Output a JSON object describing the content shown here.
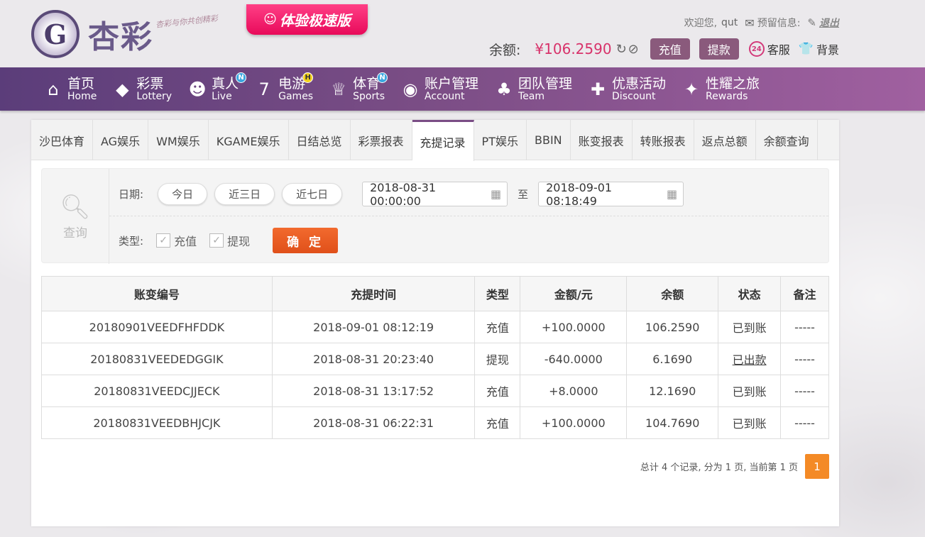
{
  "header": {
    "logo_mark": "G",
    "logo_text": "杏彩",
    "slogan": "杏彩与你共创精彩",
    "fast_badge": "体验极速版",
    "welcome": "欢迎您,",
    "username": "qut",
    "reserved_info": "预留信息:",
    "logout": "退出",
    "balance_label": "余额:",
    "balance_amount": "¥106.2590",
    "deposit": "充值",
    "withdraw": "提款",
    "service": "客服",
    "background": "背景",
    "service_badge": "24"
  },
  "nav": [
    {
      "zh": "首页",
      "en": "Home",
      "icon": "home-icon",
      "glyph": "⌂",
      "tag": ""
    },
    {
      "zh": "彩票",
      "en": "Lottery",
      "icon": "lottery-icon",
      "glyph": "◆",
      "tag": ""
    },
    {
      "zh": "真人",
      "en": "Live",
      "icon": "live-icon",
      "glyph": "☻",
      "tag": "N"
    },
    {
      "zh": "电游",
      "en": "Games",
      "icon": "games-icon",
      "glyph": "7",
      "tag": "H"
    },
    {
      "zh": "体育",
      "en": "Sports",
      "icon": "sports-icon",
      "glyph": "♕",
      "tag": "N"
    },
    {
      "zh": "账户管理",
      "en": "Account",
      "icon": "account-icon",
      "glyph": "◉",
      "tag": ""
    },
    {
      "zh": "团队管理",
      "en": "Team",
      "icon": "team-icon",
      "glyph": "♣",
      "tag": ""
    },
    {
      "zh": "优惠活动",
      "en": "Discount",
      "icon": "gift-icon",
      "glyph": "✚",
      "tag": ""
    },
    {
      "zh": "性耀之旅",
      "en": "Rewards",
      "icon": "rewards-icon",
      "glyph": "✦",
      "tag": ""
    }
  ],
  "tabs": [
    "沙巴体育",
    "AG娱乐",
    "WM娱乐",
    "KGAME娱乐",
    "日结总览",
    "彩票报表",
    "充提记录",
    "PT娱乐",
    "BBIN",
    "账变报表",
    "转账报表",
    "返点总额",
    "余额查询"
  ],
  "active_tab": "充提记录",
  "filter": {
    "query_label": "查询",
    "date_label": "日期:",
    "today": "今日",
    "last3": "近三日",
    "last7": "近七日",
    "start_date": "2018-08-31 00:00:00",
    "to": "至",
    "end_date": "2018-09-01 08:18:49",
    "type_label": "类型:",
    "type_deposit": "充值",
    "type_withdraw": "提现",
    "confirm": "确 定"
  },
  "table": {
    "headers": [
      "账变编号",
      "充提时间",
      "类型",
      "金额/元",
      "余额",
      "状态",
      "备注"
    ],
    "rows": [
      {
        "id": "20180901VEEDFHFDDK",
        "time": "2018-09-01 08:12:19",
        "type": "充值",
        "amount": "+100.0000",
        "balance": "106.2590",
        "status": "已到账",
        "note": "-----"
      },
      {
        "id": "20180831VEEDEDGGIK",
        "time": "2018-08-31 20:23:40",
        "type": "提现",
        "amount": "-640.0000",
        "balance": "6.1690",
        "status": "已出款",
        "note": "-----"
      },
      {
        "id": "20180831VEEDCJJECK",
        "time": "2018-08-31 13:17:52",
        "type": "充值",
        "amount": "+8.0000",
        "balance": "12.1690",
        "status": "已到账",
        "note": "-----"
      },
      {
        "id": "20180831VEEDBHJCJK",
        "time": "2018-08-31 06:22:31",
        "type": "充值",
        "amount": "+100.0000",
        "balance": "104.7690",
        "status": "已到账",
        "note": "-----"
      }
    ]
  },
  "pager": {
    "summary": "总计 4 个记录, 分为 1 页, 当前第 1 页",
    "current": "1"
  }
}
